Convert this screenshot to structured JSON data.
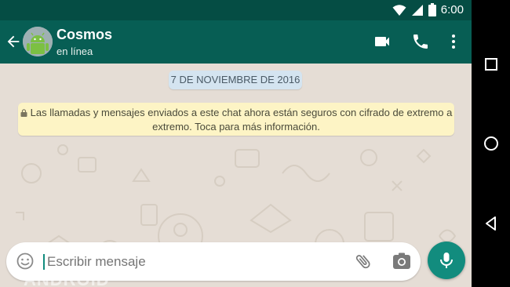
{
  "status_bar": {
    "time": "6:00"
  },
  "header": {
    "contact_name": "Cosmos",
    "contact_status": "en línea"
  },
  "chat": {
    "date_chip": "7 DE NOVIEMBRE DE 2016",
    "encryption_notice": "Las llamadas y mensajes enviados a este chat ahora están seguros con cifrado de extremo a extremo. Toca para más información."
  },
  "composer": {
    "placeholder": "Escribir mensaje"
  },
  "watermark": {
    "text": "ANDROID"
  },
  "colors": {
    "header": "#075e54",
    "status_bar": "#054d44",
    "accent": "#128c7e",
    "chat_bg": "#e5ddd5",
    "notice_bg": "#fdf4c5",
    "date_chip_bg": "#d4e4f0"
  }
}
